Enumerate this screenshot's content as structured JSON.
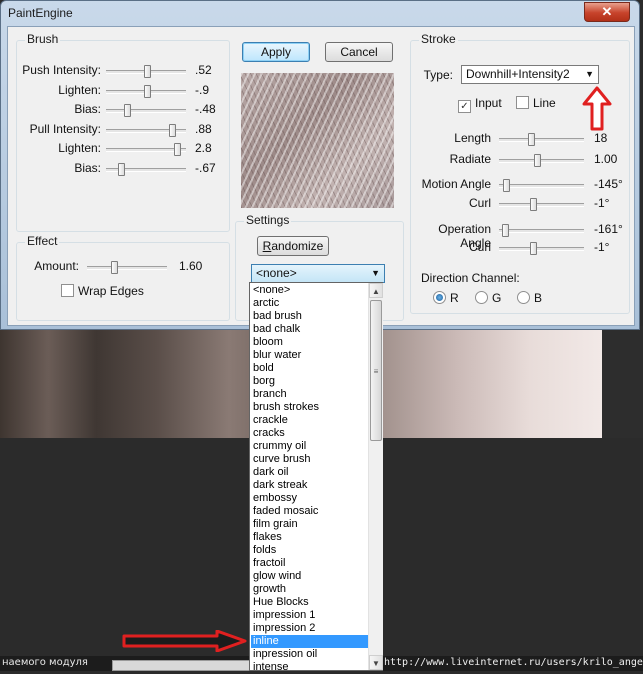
{
  "window": {
    "title": "PaintEngine",
    "close_glyph": "✕"
  },
  "brush": {
    "legend": "Brush",
    "rows": [
      {
        "label": "Push Intensity:",
        "value": ".52",
        "level": 0.52
      },
      {
        "label": "Lighten:",
        "value": "-.9",
        "level": 0.52
      },
      {
        "label": "Bias:",
        "value": "-.48",
        "level": 0.24
      },
      {
        "label": "Pull Intensity:",
        "value": ".88",
        "level": 0.86
      },
      {
        "label": "Lighten:",
        "value": "2.8",
        "level": 0.93
      },
      {
        "label": "Bias:",
        "value": "-.67",
        "level": 0.17
      }
    ]
  },
  "buttons": {
    "apply": "Apply",
    "cancel": "Cancel"
  },
  "effect": {
    "legend": "Effect",
    "amount_label": "Amount:",
    "amount_value": "1.60",
    "amount_level": 0.33,
    "wrap_edges": "Wrap Edges"
  },
  "settings": {
    "legend": "Settings",
    "randomize_r": "R",
    "randomize_rest": "andomize",
    "selected": "<none>",
    "arrow": "▼"
  },
  "stroke": {
    "legend": "Stroke",
    "type_label": "Type:",
    "type_value": "Downhill+Intensity2",
    "arrow": "▼",
    "input_label": "Input",
    "input_checked": true,
    "line_label": "Line",
    "line_checked": false,
    "check_glyph": "✓",
    "rows": [
      {
        "label": "Length",
        "value": "18",
        "level": 0.37
      },
      {
        "label": "Radiate",
        "value": "1.00",
        "level": 0.45
      },
      {
        "label": "Motion Angle",
        "value": "-145°",
        "level": 0.05
      },
      {
        "label": "Curl",
        "value": "-1°",
        "level": 0.4
      },
      {
        "label": "Operation Angle",
        "value": "-161°",
        "level": 0.04
      },
      {
        "label": "Curl",
        "value": "-1°",
        "level": 0.4
      }
    ],
    "direction_label": "Direction Channel:",
    "channels": [
      "R",
      "G",
      "B"
    ],
    "channel_selected": "R"
  },
  "dropdown": {
    "items": [
      "<none>",
      "arctic",
      "bad brush",
      "bad chalk",
      "bloom",
      "blur water",
      "bold",
      "borg",
      "branch",
      "brush strokes",
      "crackle",
      "cracks",
      "crummy oil",
      "curve brush",
      "dark oil",
      "dark streak",
      "embossy",
      "faded mosaic",
      "film grain",
      "flakes",
      "folds",
      "fractoil",
      "glow wind",
      "growth",
      "Hue Blocks",
      "impression 1",
      "impression 2",
      "inline",
      "inpression oil",
      "intense"
    ],
    "highlighted": "inline",
    "up": "▲",
    "down": "▼",
    "grip": "≡"
  },
  "background": {
    "bottom_left_text": "наемого модуля",
    "bottom_right_text": "http://www.liveinternet.ru/users/krilo_angela/"
  },
  "colors": {
    "accent": "#3399ff",
    "annotation_red": "#e02020"
  }
}
